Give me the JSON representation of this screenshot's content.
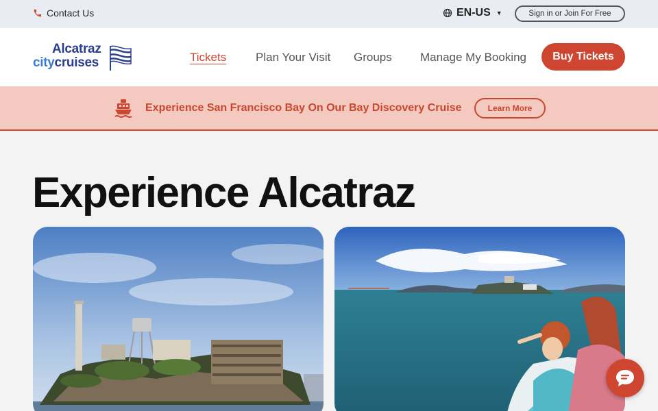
{
  "utility": {
    "contact_label": "Contact Us",
    "language": "EN-US",
    "signin_label": "Sign in or Join For Free"
  },
  "logo": {
    "line1": "Alcatraz",
    "line2_a": "city",
    "line2_b": "cruises"
  },
  "nav": {
    "items": [
      {
        "label": "Tickets",
        "active": true
      },
      {
        "label": "Plan Your Visit",
        "active": false
      },
      {
        "label": "Groups",
        "active": false
      },
      {
        "label": "Manage My Booking",
        "active": false
      }
    ],
    "buy_label": "Buy Tickets"
  },
  "promo": {
    "text": "Experience San Francisco Bay On Our Bay Discovery Cruise",
    "button_label": "Learn More"
  },
  "main": {
    "title": "Experience Alcatraz"
  },
  "colors": {
    "brand": "#cf4630",
    "brand_text": "#c8472f",
    "promo_bg": "#f4c9bf",
    "logo_blue": "#2c3e8f"
  },
  "icons": {
    "contact": "phone-icon",
    "language": "globe-icon",
    "promo": "ship-icon",
    "chat": "chat-icon"
  }
}
